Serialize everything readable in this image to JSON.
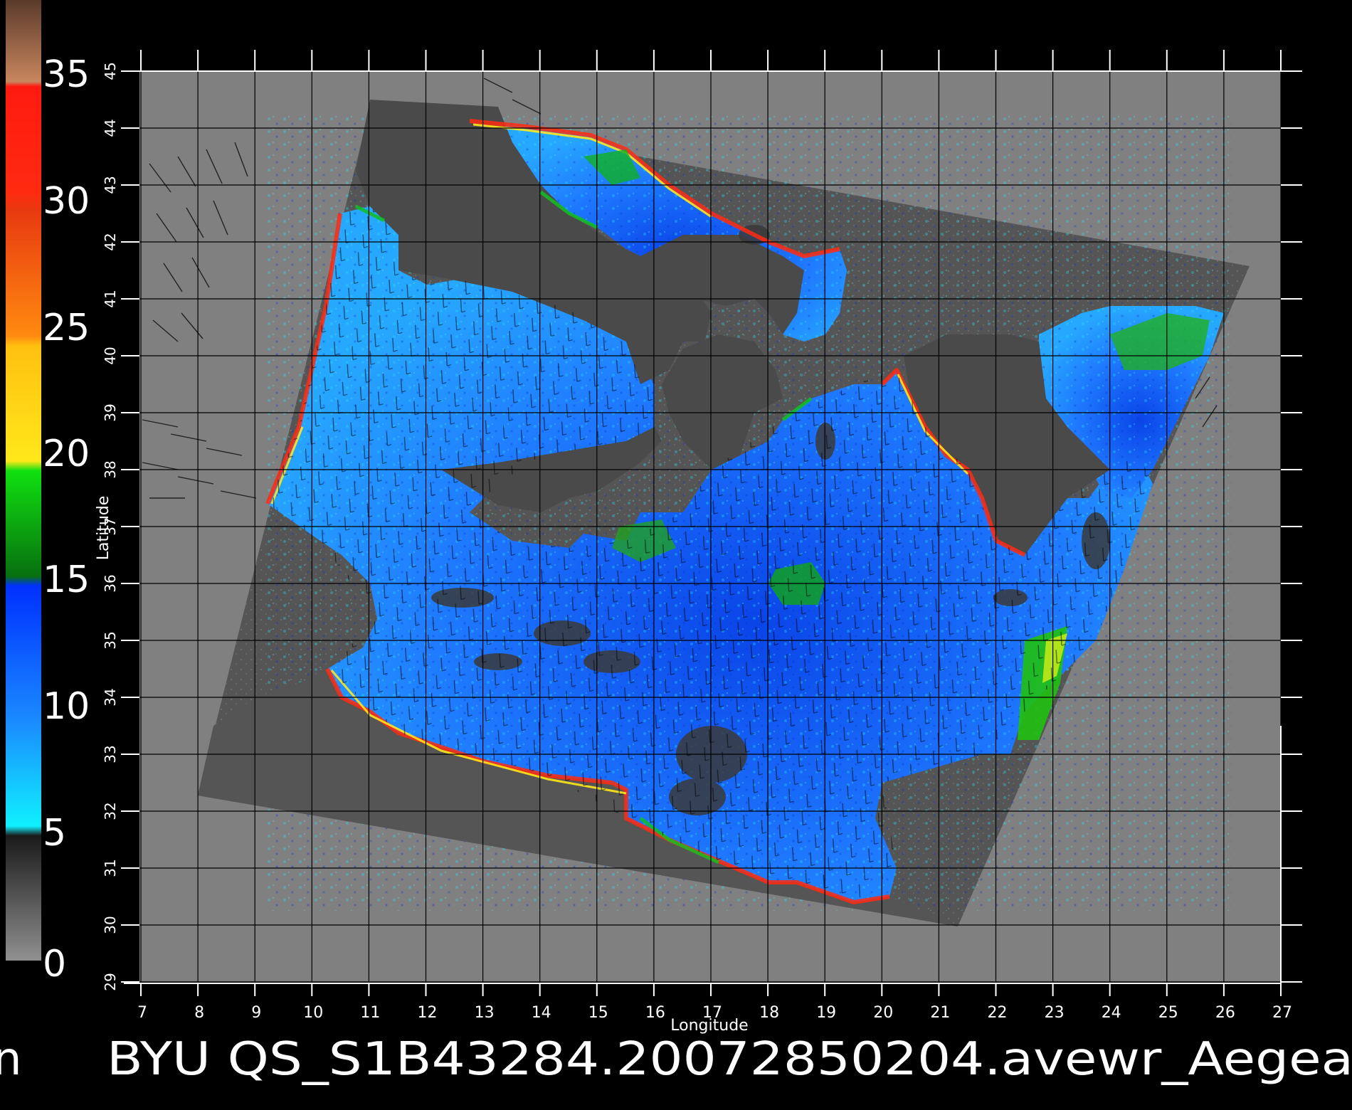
{
  "colorbar": {
    "labels": [
      "35",
      "30",
      "25",
      "20",
      "15",
      "10",
      "5",
      "0"
    ],
    "colors": {
      "brown": "#b87a54",
      "red": "#ff1a10",
      "orange": "#ff7a10",
      "yellow": "#ffd21a",
      "green": "#10c020",
      "blue": "#0a5cff",
      "cyan": "#10e0ff",
      "gray": "#5a5a5a"
    }
  },
  "axes": {
    "xlabel": "Longitude",
    "ylabel": "Latitude",
    "x_ticks": [
      "7",
      "8",
      "9",
      "10",
      "11",
      "12",
      "13",
      "14",
      "15",
      "16",
      "17",
      "18",
      "19",
      "20",
      "21",
      "22",
      "23",
      "24",
      "25",
      "26",
      "27"
    ],
    "y_ticks": [
      "29",
      "30",
      "31",
      "32",
      "33",
      "34",
      "35",
      "36",
      "37",
      "38",
      "39",
      "40",
      "41",
      "42",
      "43",
      "44",
      "45"
    ]
  },
  "map": {
    "background": "#808080",
    "swath": "#555555",
    "land": "#4a4a4a",
    "sea": "#1a6aff",
    "wind_vector_color": "#000000",
    "grid_color": "#000000"
  },
  "caption": {
    "left_fragment": "n",
    "text": "BYU QS_S1B43284.20072850204.avewr_Aegea"
  }
}
